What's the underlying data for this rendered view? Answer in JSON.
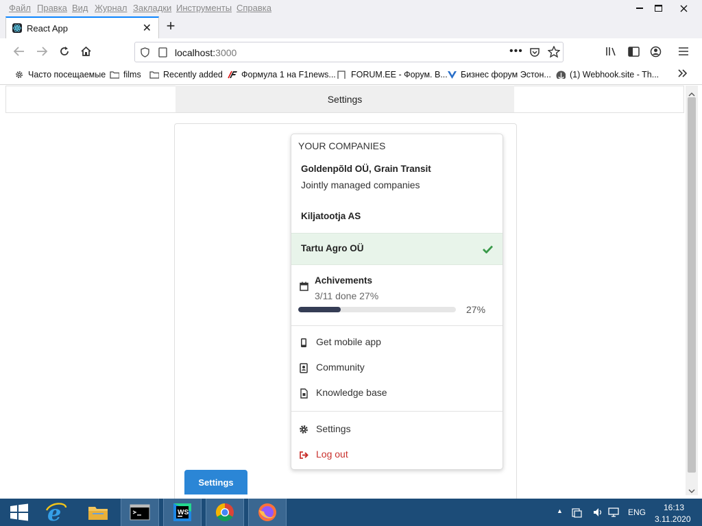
{
  "menubar": {
    "items": [
      "Файл",
      "Правка",
      "Вид",
      "Журнал",
      "Закладки",
      "Инструменты",
      "Справка"
    ]
  },
  "tab": {
    "title": "React App",
    "close": "✕",
    "new_tab": "+"
  },
  "navbar": {
    "url_host": "localhost:",
    "url_port": "3000"
  },
  "bookmarks": [
    {
      "label": "Часто посещаемые",
      "icon": "gear-icon"
    },
    {
      "label": "films",
      "icon": "folder-icon"
    },
    {
      "label": "Recently added",
      "icon": "folder-icon"
    },
    {
      "label": "Формула 1 на F1news...",
      "icon": "f1-logo-icon"
    },
    {
      "label": "FORUM.EE - Форум. В...",
      "icon": "page-icon"
    },
    {
      "label": "Бизнес форум Эстон...",
      "icon": "v-logo-icon"
    },
    {
      "label": "(1) Webhook.site - Th...",
      "icon": "anchor-icon"
    }
  ],
  "page": {
    "topbar_settings": "Settings",
    "settings_button": "Settings"
  },
  "dropdown": {
    "header": "YOUR COMPANIES",
    "companies": [
      {
        "name": "Goldenpõld OÜ, Grain Transit",
        "subtitle": "Jointly managed companies"
      },
      {
        "name": "Kiljatootja AS"
      },
      {
        "name": "Tartu Agro OÜ",
        "active": true
      }
    ],
    "achievements": {
      "title": "Achivements",
      "summary": "3/11 done 27%",
      "percent_label": "27%",
      "progress": 0.27
    },
    "links": [
      {
        "label": "Get mobile app",
        "icon": "mobile-phone-icon"
      },
      {
        "label": "Community",
        "icon": "address-book-icon"
      },
      {
        "label": "Knowledge base",
        "icon": "file-icon"
      }
    ],
    "settings": {
      "label": "Settings",
      "icon": "gear-icon"
    },
    "logout": {
      "label": "Log out",
      "icon": "sign-out-icon",
      "color": "#c9302c"
    },
    "check_color": "#3a9a4a"
  },
  "taskbar": {
    "lang": "ENG",
    "time": "16:13",
    "date": "3.11.2020"
  }
}
